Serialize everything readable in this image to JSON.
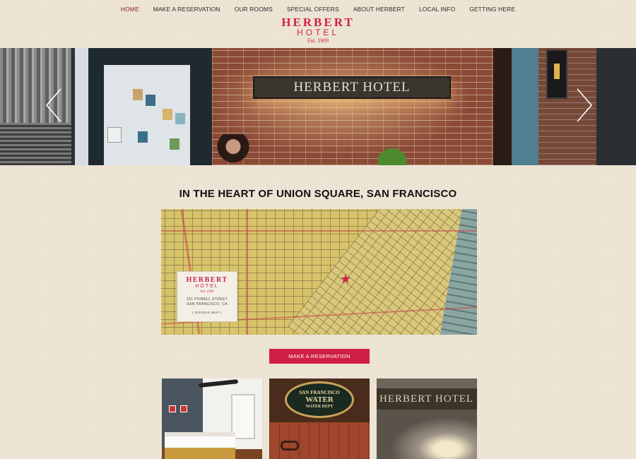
{
  "nav": {
    "items": [
      {
        "label": "HOME",
        "active": true
      },
      {
        "label": "MAKE A RESERVATION",
        "active": false
      },
      {
        "label": "OUR ROOMS",
        "active": false
      },
      {
        "label": "SPECIAL OFFERS",
        "active": false
      },
      {
        "label": "ABOUT HERBERT",
        "active": false
      },
      {
        "label": "LOCAL INFO",
        "active": false
      },
      {
        "label": "GETTING HERE",
        "active": false
      }
    ]
  },
  "logo": {
    "line1": "HERBERT",
    "line2": "HOTEL",
    "line3": "Est. 1909"
  },
  "hero": {
    "sign_text": "HERBERT HOTEL",
    "prev_icon": "chevron-left-icon",
    "next_icon": "chevron-right-icon"
  },
  "heading": "IN THE HEART OF UNION SQUARE, SAN FRANCISCO",
  "map_card": {
    "name": "HERBERT",
    "sub": "HOTEL",
    "est": "Est. 1909",
    "address1": "161 POWELL STREET",
    "address2": "SAN FRANCISCO, CA",
    "link": "( GOOGLE MAP )"
  },
  "reservation_button": "MAKE A RESERVATION",
  "thumbs": {
    "sign2_line1": "SAN FRANCISCO",
    "sign2_line2": "WATER",
    "sign2_line3": "WATER DEPT",
    "sign3_text": "HERBERT HOTEL"
  },
  "colors": {
    "accent": "#d01f44",
    "nav_active": "#8a1e2c",
    "background": "#ede4d4"
  }
}
